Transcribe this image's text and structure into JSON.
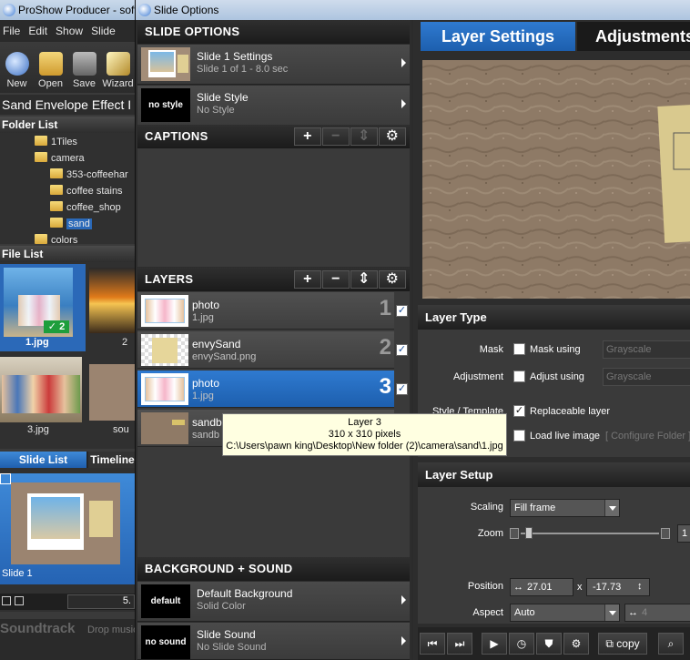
{
  "main_window": {
    "title": "ProShow Producer - softw",
    "menu": [
      "File",
      "Edit",
      "Show",
      "Slide"
    ],
    "toolbar": [
      "New",
      "Open",
      "Save",
      "Wizard"
    ],
    "show_name": "Sand Envelope Effect I",
    "folder_list": {
      "header": "Folder List",
      "items": [
        {
          "label": "1Tiles",
          "level": 1,
          "selected": false
        },
        {
          "label": "camera",
          "level": 1,
          "selected": false
        },
        {
          "label": "353-coffeehar",
          "level": 2,
          "selected": false
        },
        {
          "label": "coffee stains",
          "level": 2,
          "selected": false
        },
        {
          "label": "coffee_shop",
          "level": 2,
          "selected": false
        },
        {
          "label": "sand",
          "level": 2,
          "selected": true
        },
        {
          "label": "colors",
          "level": 1,
          "selected": false
        }
      ]
    },
    "file_list": {
      "header": "File List",
      "files": [
        "1.jpg",
        "2",
        "3.jpg",
        "sou"
      ],
      "used_badge": "2"
    },
    "slide_tabs": [
      "Slide List",
      "Timeline"
    ],
    "slide_list": {
      "slide_label": "Slide 1",
      "duration": "5."
    },
    "soundtrack": {
      "label": "Soundtrack",
      "hint": "Drop music"
    }
  },
  "dialog": {
    "title": "Slide Options",
    "slide_options": {
      "header": "SLIDE OPTIONS",
      "settings": {
        "title": "Slide 1 Settings",
        "subtitle": "Slide 1 of 1 - 8.0 sec"
      },
      "style": {
        "thumb_label": "no style",
        "title": "Slide Style",
        "subtitle": "No Style"
      }
    },
    "captions": {
      "header": "CAPTIONS"
    },
    "layers": {
      "header": "LAYERS",
      "items": [
        {
          "name": "photo",
          "file": "1.jpg",
          "number": "1",
          "checked": true,
          "selected": false
        },
        {
          "name": "envySand",
          "file": "envySand.png",
          "number": "2",
          "checked": true,
          "selected": false
        },
        {
          "name": "photo",
          "file": "1.jpg",
          "number": "3",
          "checked": true,
          "selected": true
        },
        {
          "name": "sandb",
          "file": "sandb",
          "number": "",
          "checked": false,
          "selected": false
        }
      ]
    },
    "tooltip": {
      "line1": "Layer 3",
      "line2": "310 x 310 pixels",
      "line3": "C:\\Users\\pawn king\\Desktop\\New folder (2)\\camera\\sand\\1.jpg"
    },
    "background_sound": {
      "header": "BACKGROUND + SOUND",
      "background": {
        "thumb_label": "default",
        "title": "Default Background",
        "subtitle": "Solid Color"
      },
      "sound": {
        "thumb_label": "no sound",
        "title": "Slide Sound",
        "subtitle": "No Slide Sound"
      }
    },
    "tabs": [
      "Layer Settings",
      "Adjustments"
    ],
    "layer_type": {
      "header": "Layer Type",
      "mask_label": "Mask",
      "mask_check": "Mask using",
      "mask_select": "Grayscale",
      "adjust_label": "Adjustment",
      "adjust_check": "Adjust using",
      "adjust_select": "Grayscale",
      "style_label": "Style / Template",
      "replaceable": "Replaceable layer",
      "live_image": "Load live image",
      "configure": "[ Configure Folder ]"
    },
    "layer_setup": {
      "header": "Layer Setup",
      "scaling_label": "Scaling",
      "scaling_value": "Fill frame",
      "zoom_label": "Zoom",
      "zoom_value": "1",
      "position_label": "Position",
      "pos_x": "27.01",
      "pos_sep": "x",
      "pos_y": "-17.73",
      "aspect_label": "Aspect",
      "aspect_value": "Auto",
      "aspect_w": "4"
    },
    "bottom_bar": {
      "copy": "copy"
    }
  }
}
